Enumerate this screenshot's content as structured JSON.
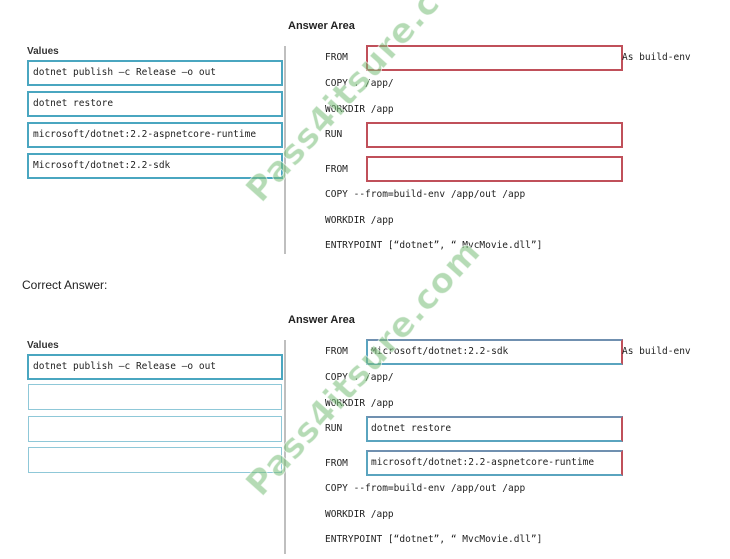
{
  "question": {
    "answer_area_title": "Answer Area",
    "values_label": "Values",
    "values": [
      "dotnet publish –c Release –o out",
      "dotnet restore",
      "microsoft/dotnet:2.2-aspnetcore-runtime",
      "Microsoft/dotnet:2.2-sdk"
    ],
    "dockerfile": {
      "from1_keyword": "FROM",
      "from1_slot": "",
      "as_build_env": "As build-env",
      "copy1": "COPY . /app/",
      "workdir1": "WORKDIR /app",
      "run_keyword": "RUN",
      "run_slot": "",
      "from2_keyword": "FROM",
      "from2_slot": "",
      "copy2": "COPY --from=build-env /app/out /app",
      "workdir2": "WORKDIR /app",
      "entrypoint": "ENTRYPOINT [“dotnet”, “ MvcMovie.dll”]"
    }
  },
  "correct_answer_label": "Correct Answer:",
  "answer": {
    "answer_area_title": "Answer Area",
    "values_label": "Values",
    "values": [
      "dotnet publish –c Release –o out",
      "",
      "",
      ""
    ],
    "dockerfile": {
      "from1_keyword": "FROM",
      "from1_slot": "Microsoft/dotnet:2.2-sdk",
      "as_build_env": "As build-env",
      "copy1": "COPY . /app/",
      "workdir1": "WORKDIR /app",
      "run_keyword": "RUN",
      "run_slot": "dotnet restore",
      "from2_keyword": "FROM",
      "from2_slot": "microsoft/dotnet:2.2-aspnetcore-runtime",
      "copy2": "COPY --from=build-env /app/out /app",
      "workdir2": "WORKDIR /app",
      "entrypoint": "ENTRYPOINT [“dotnet”, “ MvcMovie.dll”]"
    }
  },
  "watermark": {
    "text": "Pass4itsure.com"
  },
  "colors": {
    "value_border": "#4aa6c0",
    "slot_border": "#c0505a",
    "watermark": "#78be78"
  }
}
